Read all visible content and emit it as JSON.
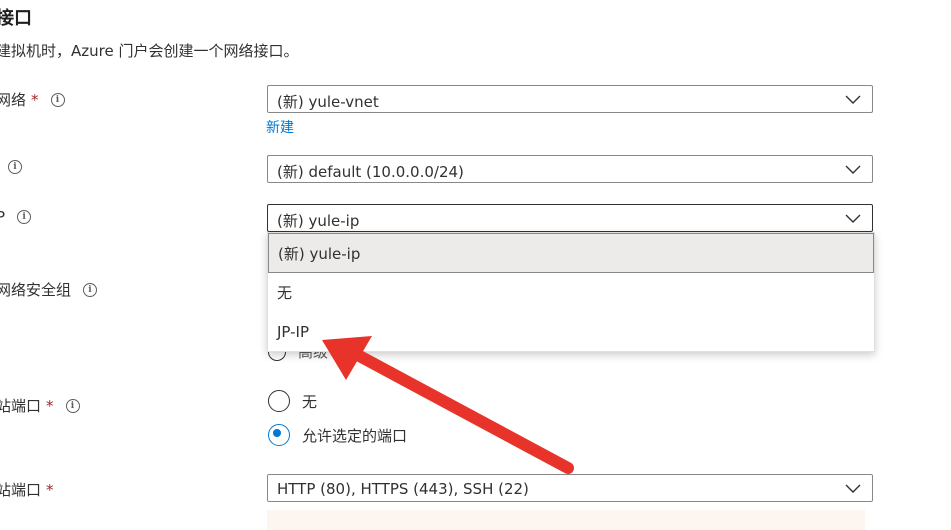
{
  "section": {
    "title": "接口",
    "description": "建拟机时，Azure 门户会创建一个网络接口。"
  },
  "fields": {
    "vnet": {
      "label": "网络",
      "required": "*",
      "value": "(新) yule-vnet",
      "new_link": "新建"
    },
    "subnet": {
      "label": "",
      "value": "(新) default (10.0.0.0/24)"
    },
    "public_ip": {
      "label": "P",
      "value": "(新) yule-ip"
    },
    "nsg": {
      "label": "网络安全组",
      "hidden_option_partial": "高级"
    },
    "public_inbound_ports": {
      "label": "站端口",
      "required": "*",
      "options": [
        "无",
        "允许选定的端口"
      ],
      "selected": "允许选定的端口"
    },
    "select_inbound_ports": {
      "label": "站端口",
      "required": "*",
      "value": "HTTP (80), HTTPS (443), SSH (22)"
    }
  },
  "dropdown": {
    "options": [
      "(新) yule-ip",
      "无",
      "JP-IP"
    ],
    "highlighted": "(新) yule-ip"
  },
  "colors": {
    "annotation_arrow": "#e8332a",
    "link": "#0078d4",
    "radio_selected": "#0078d4",
    "required": "#a4262c"
  }
}
